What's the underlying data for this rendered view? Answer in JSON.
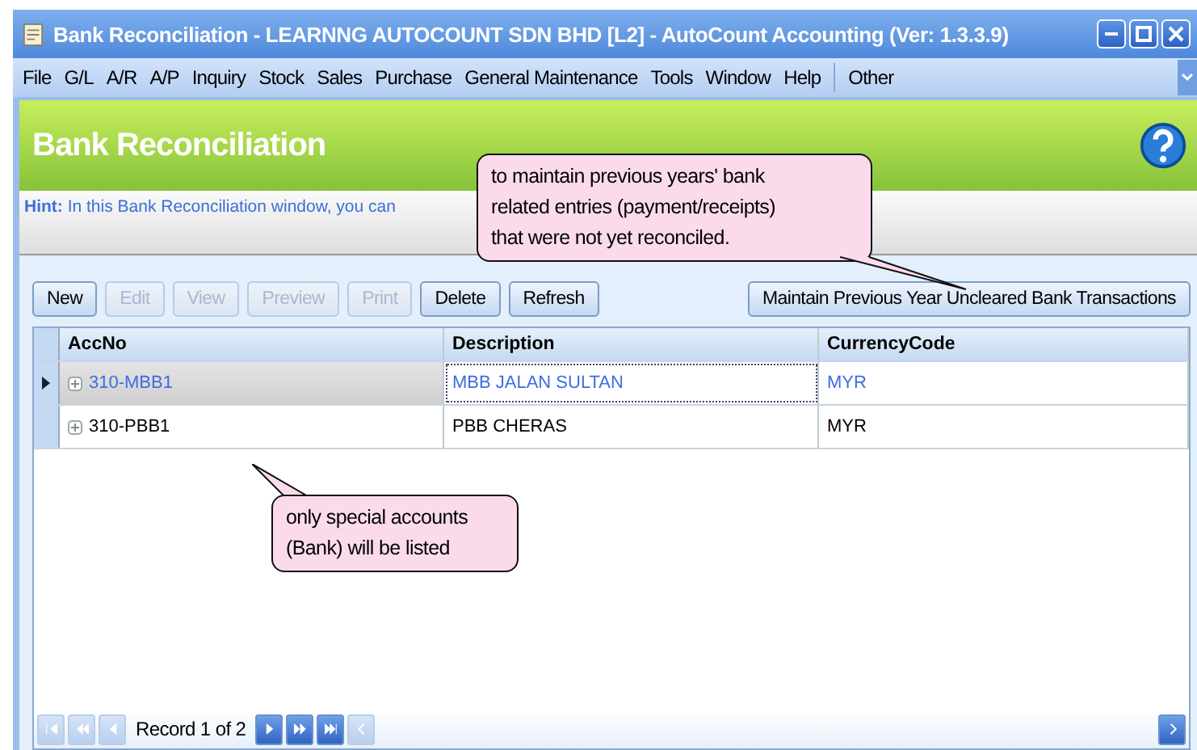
{
  "window": {
    "title": "Bank Reconciliation - LEARNNG AUTOCOUNT SDN BHD [L2] - AutoCount Accounting (Ver: 1.3.3.9)"
  },
  "menu": [
    "File",
    "G/L",
    "A/R",
    "A/P",
    "Inquiry",
    "Stock",
    "Sales",
    "Purchase",
    "General Maintenance",
    "Tools",
    "Window",
    "Help",
    "Other"
  ],
  "header": {
    "title": "Bank Reconciliation"
  },
  "hint": {
    "label": "Hint:",
    "text": "In this Bank Reconciliation window, you can"
  },
  "toolbar": [
    {
      "label": "New",
      "disabled": false
    },
    {
      "label": "Edit",
      "disabled": true
    },
    {
      "label": "View",
      "disabled": true
    },
    {
      "label": "Preview",
      "disabled": true
    },
    {
      "label": "Print",
      "disabled": true
    },
    {
      "label": "Delete",
      "disabled": false
    },
    {
      "label": "Refresh",
      "disabled": false
    }
  ],
  "maintain_button": {
    "label": "Maintain Previous Year Uncleared Bank Transactions"
  },
  "table": {
    "columns": [
      "AccNo",
      "Description",
      "CurrencyCode"
    ],
    "rows": [
      {
        "cells": [
          "310-MBB1",
          "MBB JALAN SULTAN",
          "MYR"
        ],
        "selected": true
      },
      {
        "cells": [
          "310-PBB1",
          "PBB CHERAS",
          "MYR"
        ],
        "selected": false
      }
    ]
  },
  "navigator": {
    "record": "Record 1 of 2",
    "buttons": [
      {
        "kind": "first",
        "disabled": true
      },
      {
        "kind": "prev-page",
        "disabled": true
      },
      {
        "kind": "prev",
        "disabled": true
      },
      {
        "kind": "next",
        "disabled": false
      },
      {
        "kind": "next-page",
        "disabled": false
      },
      {
        "kind": "last",
        "disabled": false
      },
      {
        "kind": "scroll-left",
        "disabled": true
      }
    ],
    "scroll_right": {
      "disabled": false
    }
  },
  "callouts": [
    {
      "kind": "top",
      "text": "to maintain previous years' bank related entries (payment/receipts) that were not yet reconciled."
    },
    {
      "kind": "bottom",
      "text": "only special accounts (Bank) will be listed"
    }
  ]
}
